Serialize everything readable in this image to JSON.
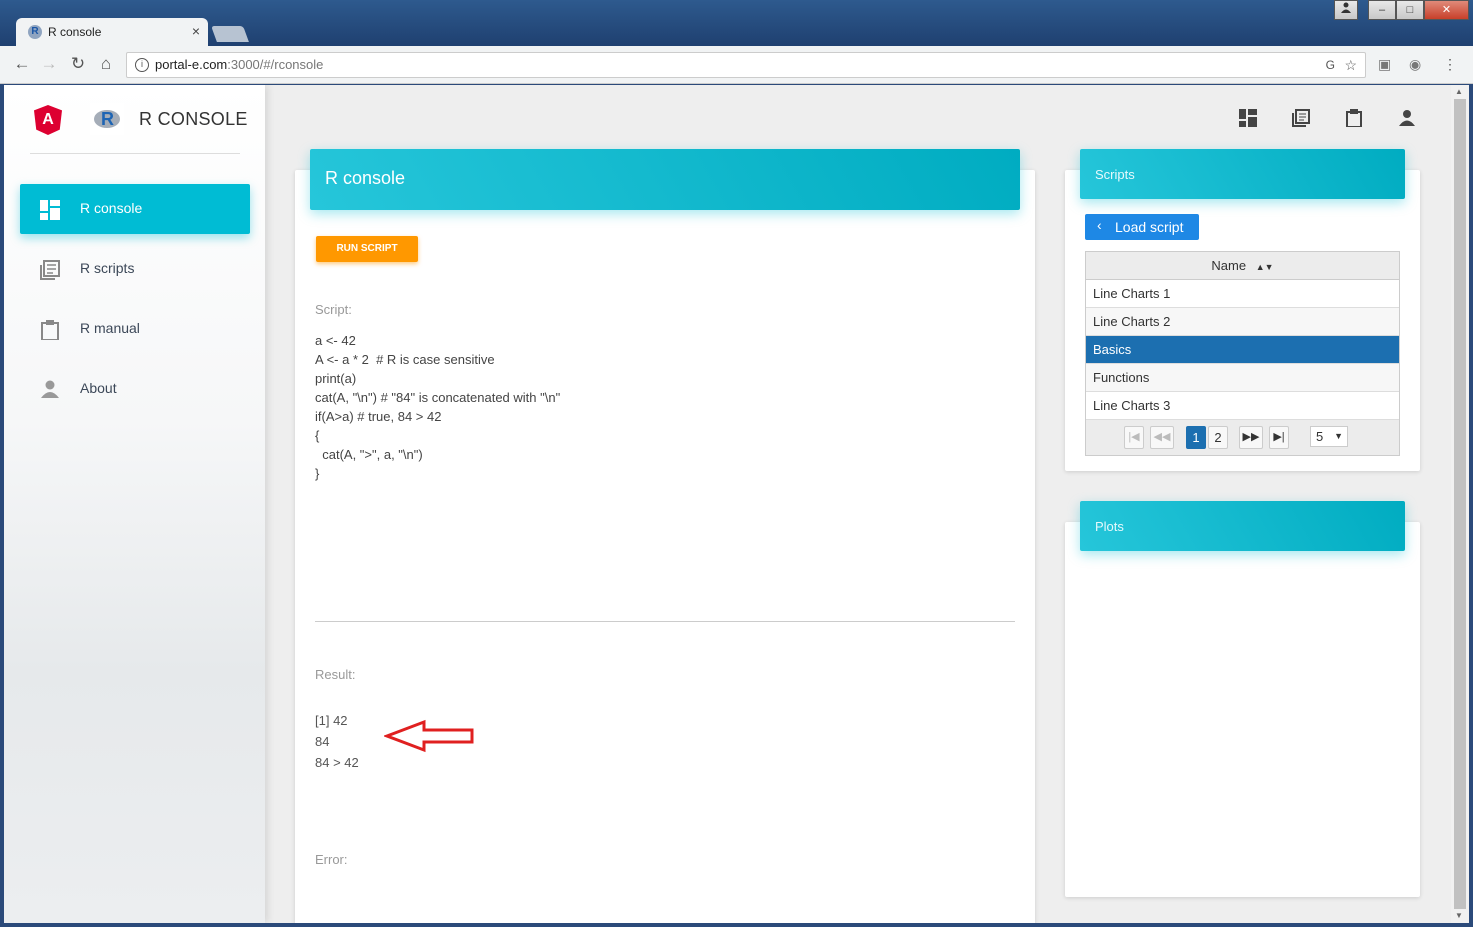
{
  "browser": {
    "tab_title": "R console",
    "tab_favicon": "R",
    "tab_close": "×",
    "url_host": "portal-e.com",
    "url_rest": ":3000/#/rconsole",
    "win_min": "–",
    "win_max": "□",
    "win_close": "✕"
  },
  "sidebar": {
    "angular_logo": "A",
    "r_logo": "R",
    "brand": "R CONSOLE",
    "items": [
      {
        "label": "R console",
        "icon": "dashboard-icon"
      },
      {
        "label": "R scripts",
        "icon": "library-books-icon"
      },
      {
        "label": "R manual",
        "icon": "clipboard-icon"
      },
      {
        "label": "About",
        "icon": "person-icon"
      }
    ]
  },
  "console": {
    "title": "R console",
    "run_label": "RUN SCRIPT",
    "script_label": "Script:",
    "script_lines": [
      "a <- 42",
      "A <- a * 2  # R is case sensitive",
      "print(a)",
      "cat(A, \"\\n\") # \"84\" is concatenated with \"\\n\"",
      "if(A>a) # true, 84 > 42",
      "{",
      "  cat(A, \">\", a, \"\\n\")",
      "}"
    ],
    "result_label": "Result:",
    "result_lines": [
      "[1] 42",
      "84",
      "84 > 42"
    ],
    "error_label": "Error:"
  },
  "scripts": {
    "title": "Scripts",
    "load_label": "Load script",
    "column_header": "Name",
    "rows": [
      "Line Charts 1",
      "Line Charts 2",
      "Basics",
      "Functions",
      "Line Charts 3"
    ],
    "selected_row": 2,
    "pager": {
      "first": "|◀",
      "prev": "◀◀",
      "pages": [
        "1",
        "2"
      ],
      "current_page": "1",
      "next": "▶▶",
      "last": "▶|",
      "page_size": "5"
    }
  },
  "plots": {
    "title": "Plots"
  },
  "colors": {
    "accent": "#00bcd4",
    "run_button": "#ff9800",
    "load_button": "#1e88e5",
    "selected_row": "#1c6fb0",
    "annotation_arrow": "#e02020"
  }
}
